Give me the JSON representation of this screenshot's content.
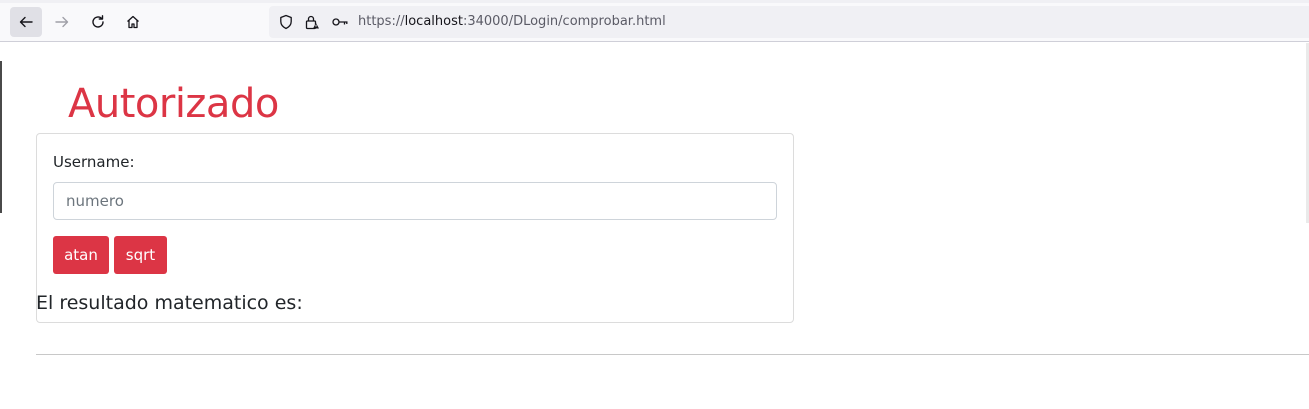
{
  "browser": {
    "url_prefix": "https://",
    "url_host": "localhost",
    "url_rest": ":34000/DLogin/comprobar.html",
    "icons": [
      "back-arrow-icon",
      "forward-arrow-icon",
      "reload-icon",
      "home-icon",
      "shield-icon",
      "insecure-lock-icon",
      "key-icon"
    ]
  },
  "page": {
    "heading": "Autorizado",
    "form": {
      "label": "Username:",
      "input_value": "",
      "input_placeholder": "numero",
      "buttons": [
        {
          "label": "atan"
        },
        {
          "label": "sqrt"
        }
      ]
    },
    "result_text": "El resultado matematico es:"
  },
  "colors": {
    "accent": "#dc3545",
    "button_text": "#ffffff",
    "text": "#212529"
  }
}
